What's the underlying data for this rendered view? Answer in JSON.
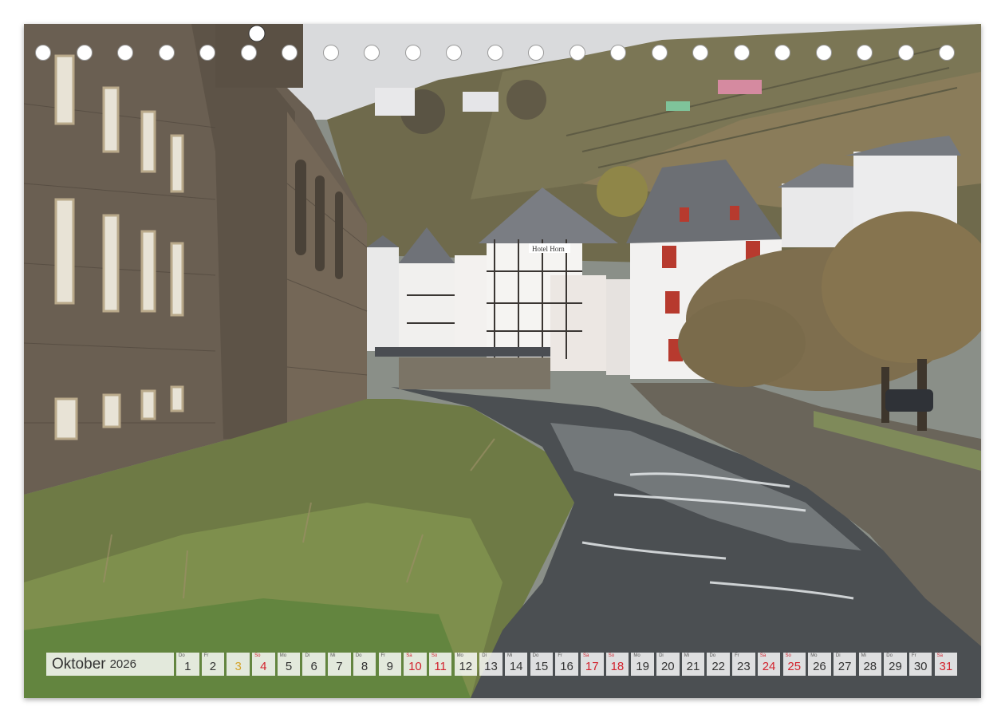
{
  "calendar": {
    "month": "Oktober",
    "year": "2026",
    "colors": {
      "weekend": "#d2222d",
      "holiday": "#d4a32a",
      "regular": "#333333"
    },
    "days": [
      {
        "wd": "Do",
        "num": "1",
        "type": "regular"
      },
      {
        "wd": "Fr",
        "num": "2",
        "type": "regular"
      },
      {
        "wd": "",
        "num": "3",
        "type": "holiday"
      },
      {
        "wd": "So",
        "num": "4",
        "type": "weekend"
      },
      {
        "wd": "Mo",
        "num": "5",
        "type": "regular"
      },
      {
        "wd": "Di",
        "num": "6",
        "type": "regular"
      },
      {
        "wd": "Mi",
        "num": "7",
        "type": "regular"
      },
      {
        "wd": "Do",
        "num": "8",
        "type": "regular"
      },
      {
        "wd": "Fr",
        "num": "9",
        "type": "regular"
      },
      {
        "wd": "Sa",
        "num": "10",
        "type": "weekend"
      },
      {
        "wd": "So",
        "num": "11",
        "type": "weekend"
      },
      {
        "wd": "Mo",
        "num": "12",
        "type": "regular"
      },
      {
        "wd": "Di",
        "num": "13",
        "type": "regular"
      },
      {
        "wd": "Mi",
        "num": "14",
        "type": "regular"
      },
      {
        "wd": "Do",
        "num": "15",
        "type": "regular"
      },
      {
        "wd": "Fr",
        "num": "16",
        "type": "regular"
      },
      {
        "wd": "Sa",
        "num": "17",
        "type": "weekend"
      },
      {
        "wd": "So",
        "num": "18",
        "type": "weekend"
      },
      {
        "wd": "Mo",
        "num": "19",
        "type": "regular"
      },
      {
        "wd": "Di",
        "num": "20",
        "type": "regular"
      },
      {
        "wd": "Mi",
        "num": "21",
        "type": "regular"
      },
      {
        "wd": "Do",
        "num": "22",
        "type": "regular"
      },
      {
        "wd": "Fr",
        "num": "23",
        "type": "regular"
      },
      {
        "wd": "Sa",
        "num": "24",
        "type": "weekend"
      },
      {
        "wd": "So",
        "num": "25",
        "type": "weekend"
      },
      {
        "wd": "Mo",
        "num": "26",
        "type": "regular"
      },
      {
        "wd": "Di",
        "num": "27",
        "type": "regular"
      },
      {
        "wd": "Mi",
        "num": "28",
        "type": "regular"
      },
      {
        "wd": "Do",
        "num": "29",
        "type": "regular"
      },
      {
        "wd": "Fr",
        "num": "30",
        "type": "regular"
      },
      {
        "wd": "Sa",
        "num": "31",
        "type": "weekend"
      }
    ]
  },
  "photo": {
    "sign_text": "Hotel Horn",
    "icon": "monschau-river-photo"
  }
}
